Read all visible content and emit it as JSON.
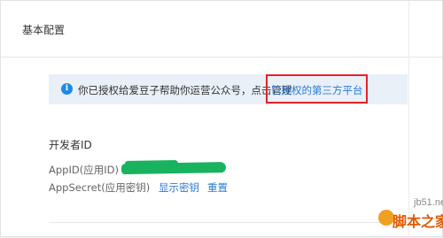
{
  "header": {
    "title": "基本配置"
  },
  "notice": {
    "icon": "info-icon",
    "icon_glyph": "i",
    "text": "你已授权给爱豆子帮助你运营公众号，点击管理",
    "link_label": "已授权的第三方平台"
  },
  "developer": {
    "section_title": "开发者ID",
    "appid_label": "AppID(应用ID)",
    "appsecret_label": "AppSecret(应用密钥)",
    "show_secret_label": "显示密钥",
    "reset_label": "重置"
  },
  "watermark": {
    "site": "jb51.net",
    "name": "脚本之家"
  },
  "colors": {
    "link": "#2b7bd6",
    "notice_bg": "#e9f0f8",
    "highlight": "#e2232a",
    "redaction": "#19b25e"
  }
}
